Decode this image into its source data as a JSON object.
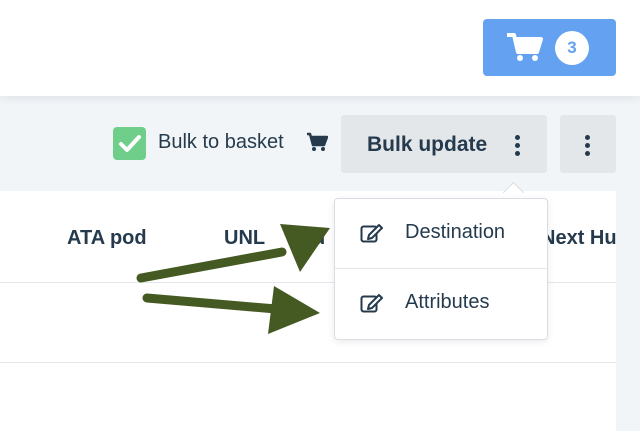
{
  "header": {
    "cart_count": "3",
    "cart_icon": "shopping-cart-icon",
    "cart_color": "#64a1f0"
  },
  "toolbar": {
    "bulk_to_basket_label": "Bulk to basket",
    "bulk_update_label": "Bulk update",
    "checkbox_color": "#6fcf8a"
  },
  "table": {
    "columns": [
      "ATA pod",
      "UNL",
      "d",
      "Next Hu"
    ]
  },
  "dropdown": {
    "items": [
      {
        "label": "Destination",
        "icon": "edit-icon"
      },
      {
        "label": "Attributes",
        "icon": "edit-icon"
      }
    ]
  },
  "annotations": {
    "arrow_color": "#445a22"
  }
}
